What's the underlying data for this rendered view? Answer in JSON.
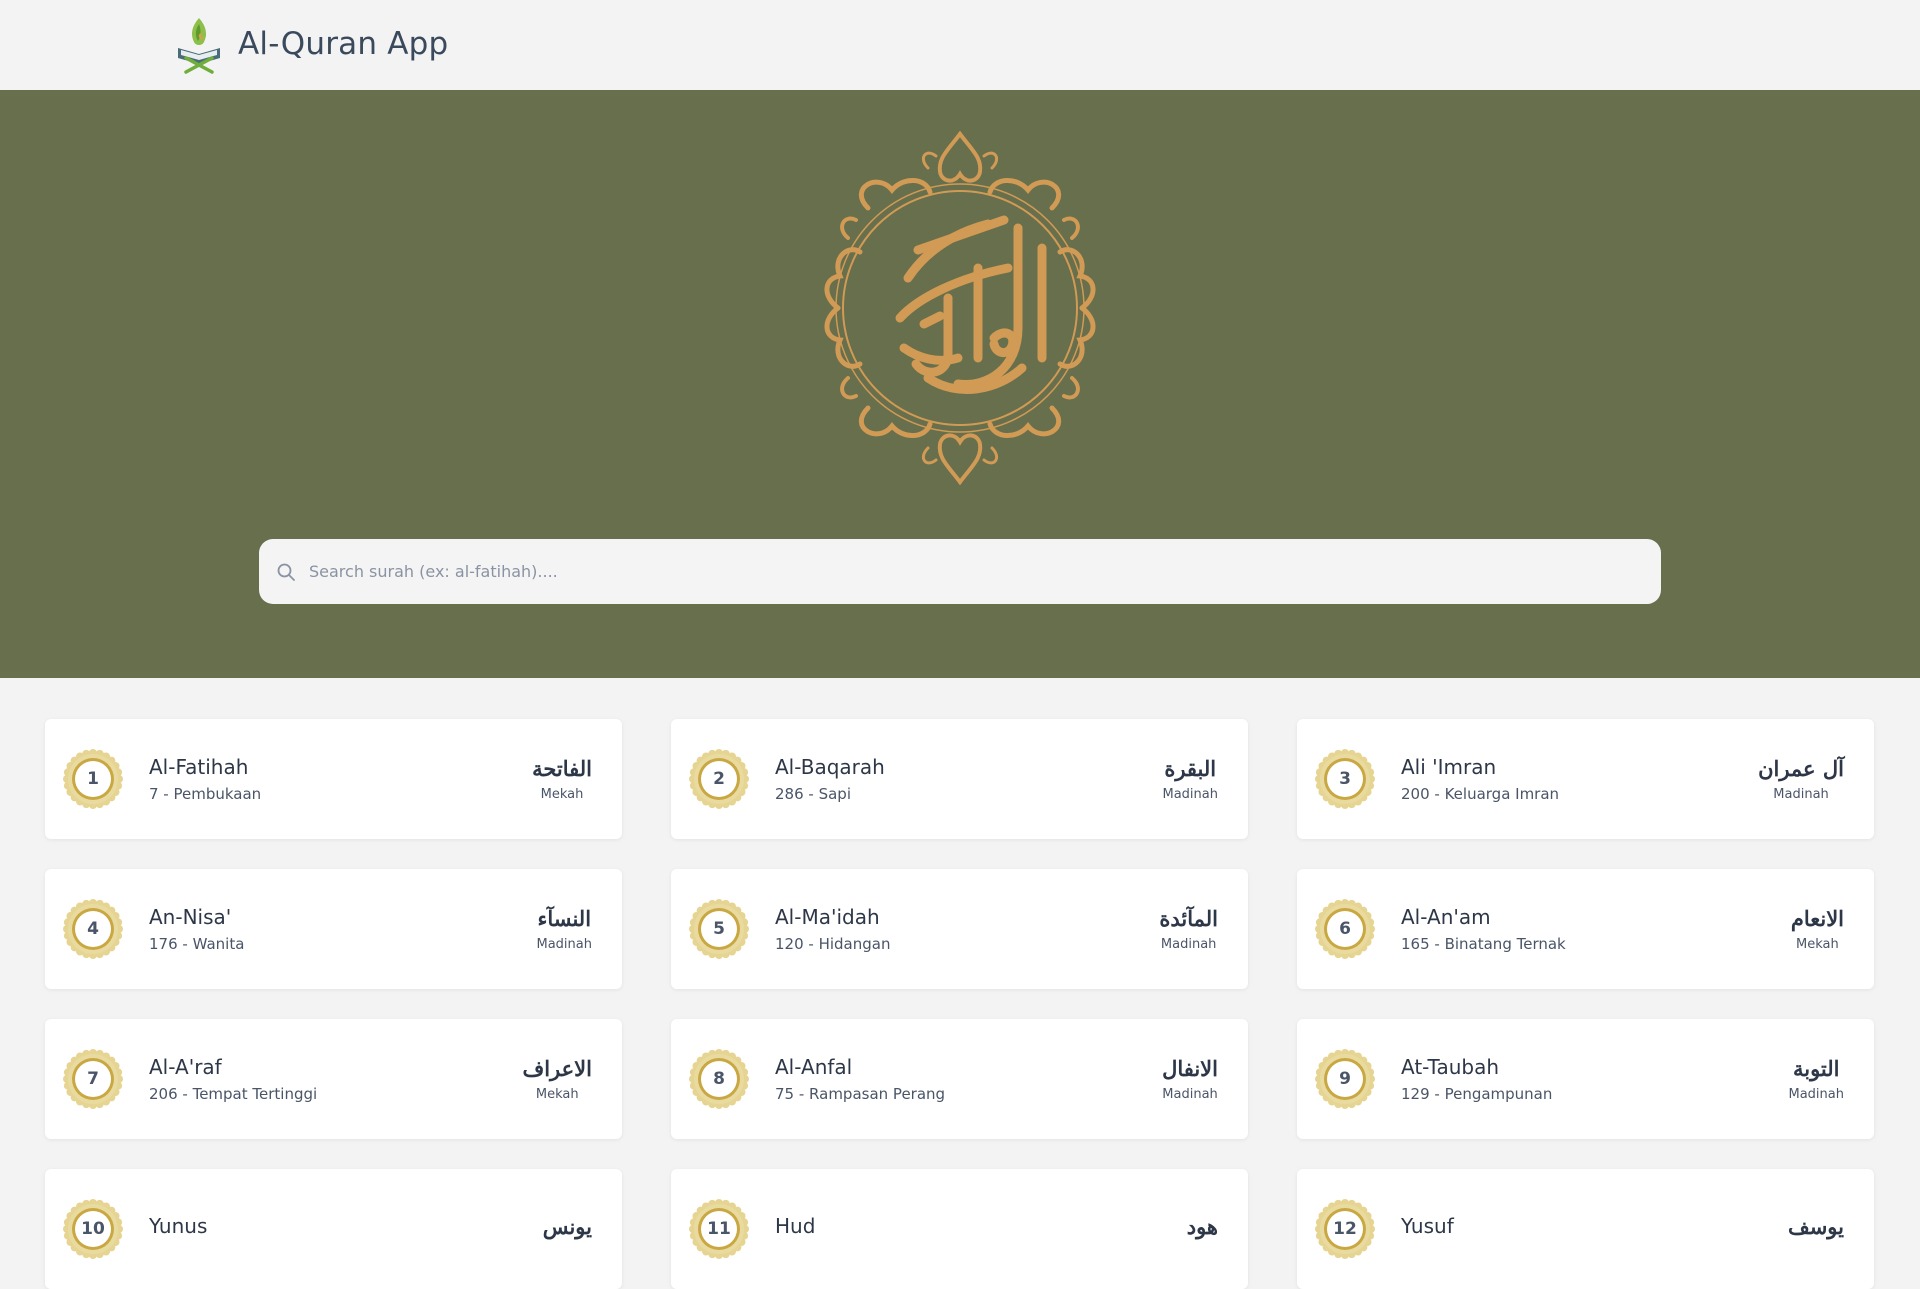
{
  "app": {
    "title": "Al-Quran App"
  },
  "search": {
    "placeholder": "Search surah (ex: al-fatihah)...."
  },
  "colors": {
    "hero": "#676f4c",
    "emblem": "#d19a55",
    "badge_gold": "#d9c27a"
  },
  "surahs": [
    {
      "number": "1",
      "name": "Al-Fatihah",
      "subtitle": "7 - Pembukaan",
      "arabic": "الفاتحة",
      "place": "Mekah"
    },
    {
      "number": "2",
      "name": "Al-Baqarah",
      "subtitle": "286 - Sapi",
      "arabic": "البقرة",
      "place": "Madinah"
    },
    {
      "number": "3",
      "name": "Ali 'Imran",
      "subtitle": "200 - Keluarga Imran",
      "arabic": "آل عمران",
      "place": "Madinah"
    },
    {
      "number": "4",
      "name": "An-Nisa'",
      "subtitle": "176 - Wanita",
      "arabic": "النسآء",
      "place": "Madinah"
    },
    {
      "number": "5",
      "name": "Al-Ma'idah",
      "subtitle": "120 - Hidangan",
      "arabic": "المآئدة",
      "place": "Madinah"
    },
    {
      "number": "6",
      "name": "Al-An'am",
      "subtitle": "165 - Binatang Ternak",
      "arabic": "الانعام",
      "place": "Mekah"
    },
    {
      "number": "7",
      "name": "Al-A'raf",
      "subtitle": "206 - Tempat Tertinggi",
      "arabic": "الاعراف",
      "place": "Mekah"
    },
    {
      "number": "8",
      "name": "Al-Anfal",
      "subtitle": "75 - Rampasan Perang",
      "arabic": "الانفال",
      "place": "Madinah"
    },
    {
      "number": "9",
      "name": "At-Taubah",
      "subtitle": "129 - Pengampunan",
      "arabic": "التوبة",
      "place": "Madinah"
    },
    {
      "number": "10",
      "name": "Yunus",
      "subtitle": "",
      "arabic": "يونس",
      "place": ""
    },
    {
      "number": "11",
      "name": "Hud",
      "subtitle": "",
      "arabic": "هود",
      "place": ""
    },
    {
      "number": "12",
      "name": "Yusuf",
      "subtitle": "",
      "arabic": "يوسف",
      "place": ""
    }
  ]
}
